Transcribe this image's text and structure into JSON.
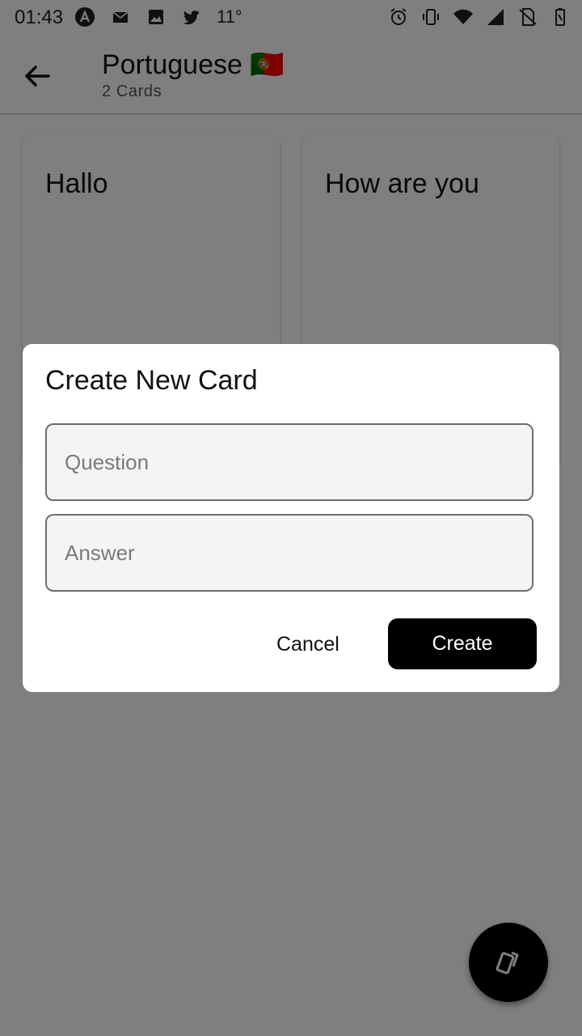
{
  "status_bar": {
    "time": "01:43",
    "temperature": "11°",
    "left_icons": [
      "app-a-icon",
      "mail-icon",
      "image-icon",
      "twitter-icon"
    ],
    "right_icons": [
      "alarm-icon",
      "vibrate-icon",
      "wifi-icon",
      "signal-icon",
      "no-sim-icon",
      "battery-icon"
    ]
  },
  "app_bar": {
    "title": "Portuguese 🇵🇹",
    "subtitle": "2 Cards"
  },
  "cards": [
    {
      "text": "Hallo"
    },
    {
      "text": "How are you"
    }
  ],
  "dialog": {
    "title": "Create New Card",
    "question_placeholder": "Question",
    "answer_placeholder": "Answer",
    "cancel_label": "Cancel",
    "create_label": "Create"
  },
  "colors": {
    "scrim": "#000000",
    "primary_button": "#000000",
    "fab": "#000000"
  }
}
